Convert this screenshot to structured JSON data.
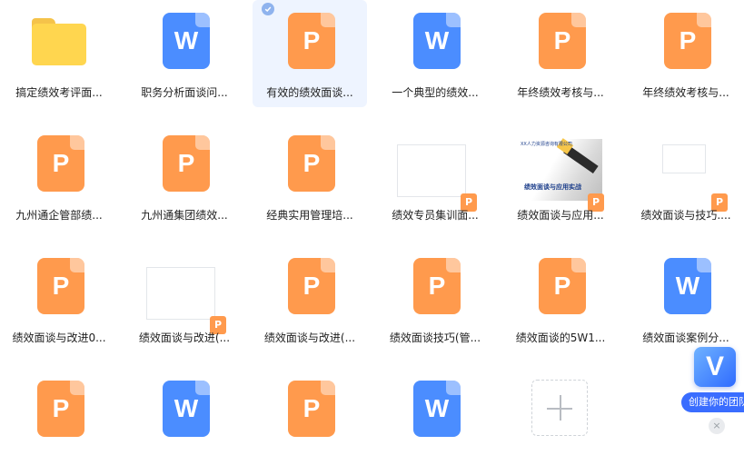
{
  "files": [
    {
      "name": "搞定绩效考评面...",
      "type": "folder",
      "icon": "folder-icon"
    },
    {
      "name": "职务分析面谈问...",
      "type": "word",
      "icon": "word-doc-icon",
      "glyph": "W"
    },
    {
      "name": "有效的绩效面谈...",
      "type": "ppt",
      "icon": "ppt-doc-icon",
      "glyph": "P",
      "selected": true
    },
    {
      "name": "一个典型的绩效...",
      "type": "word",
      "icon": "word-doc-icon",
      "glyph": "W"
    },
    {
      "name": "年终绩效考核与...",
      "type": "ppt",
      "icon": "ppt-doc-icon",
      "glyph": "P"
    },
    {
      "name": "年终绩效考核与...",
      "type": "ppt",
      "icon": "ppt-doc-icon",
      "glyph": "P"
    },
    {
      "name": "九州通企管部绩...",
      "type": "ppt",
      "icon": "ppt-doc-icon",
      "glyph": "P"
    },
    {
      "name": "九州通集团绩效...",
      "type": "ppt",
      "icon": "ppt-doc-icon",
      "glyph": "P"
    },
    {
      "name": "经典实用管理培...",
      "type": "ppt",
      "icon": "ppt-doc-icon",
      "glyph": "P"
    },
    {
      "name": "绩效专员集训面...",
      "type": "ppt-preview",
      "icon": "ppt-preview-icon",
      "glyph": "P"
    },
    {
      "name": "绩效面谈与应用...",
      "type": "ppt-preview-pencil",
      "icon": "ppt-preview-icon",
      "glyph": "P",
      "preview_title": "绩效面谈与应用实战",
      "preview_header": "XX人力资源咨询有限公司"
    },
    {
      "name": "绩效面谈与技巧....",
      "type": "ppt-preview-blank",
      "icon": "ppt-preview-icon",
      "glyph": "P"
    },
    {
      "name": "绩效面谈与改进0...",
      "type": "ppt",
      "icon": "ppt-doc-icon",
      "glyph": "P"
    },
    {
      "name": "绩效面谈与改进(...",
      "type": "ppt-preview",
      "icon": "ppt-preview-icon",
      "glyph": "P"
    },
    {
      "name": "绩效面谈与改进(...",
      "type": "ppt",
      "icon": "ppt-doc-icon",
      "glyph": "P"
    },
    {
      "name": "绩效面谈技巧(管...",
      "type": "ppt",
      "icon": "ppt-doc-icon",
      "glyph": "P"
    },
    {
      "name": "绩效面谈的5W1...",
      "type": "ppt",
      "icon": "ppt-doc-icon",
      "glyph": "P"
    },
    {
      "name": "绩效面谈案例分...",
      "type": "word",
      "icon": "word-doc-icon",
      "glyph": "W"
    },
    {
      "name": "",
      "type": "ppt",
      "icon": "ppt-doc-icon",
      "glyph": "P"
    },
    {
      "name": "",
      "type": "word",
      "icon": "word-doc-icon",
      "glyph": "W"
    },
    {
      "name": "",
      "type": "ppt",
      "icon": "ppt-doc-icon",
      "glyph": "P"
    },
    {
      "name": "",
      "type": "word",
      "icon": "word-doc-icon",
      "glyph": "W"
    }
  ],
  "add_tile": {
    "icon": "plus-icon"
  },
  "team_widget": {
    "badge": "V",
    "label": "创建你的团队",
    "close": "×"
  },
  "colors": {
    "ppt": "#ff9a4d",
    "word": "#4b8dff",
    "folder": "#ffd64f",
    "selected_bg": "#eef4ff"
  }
}
